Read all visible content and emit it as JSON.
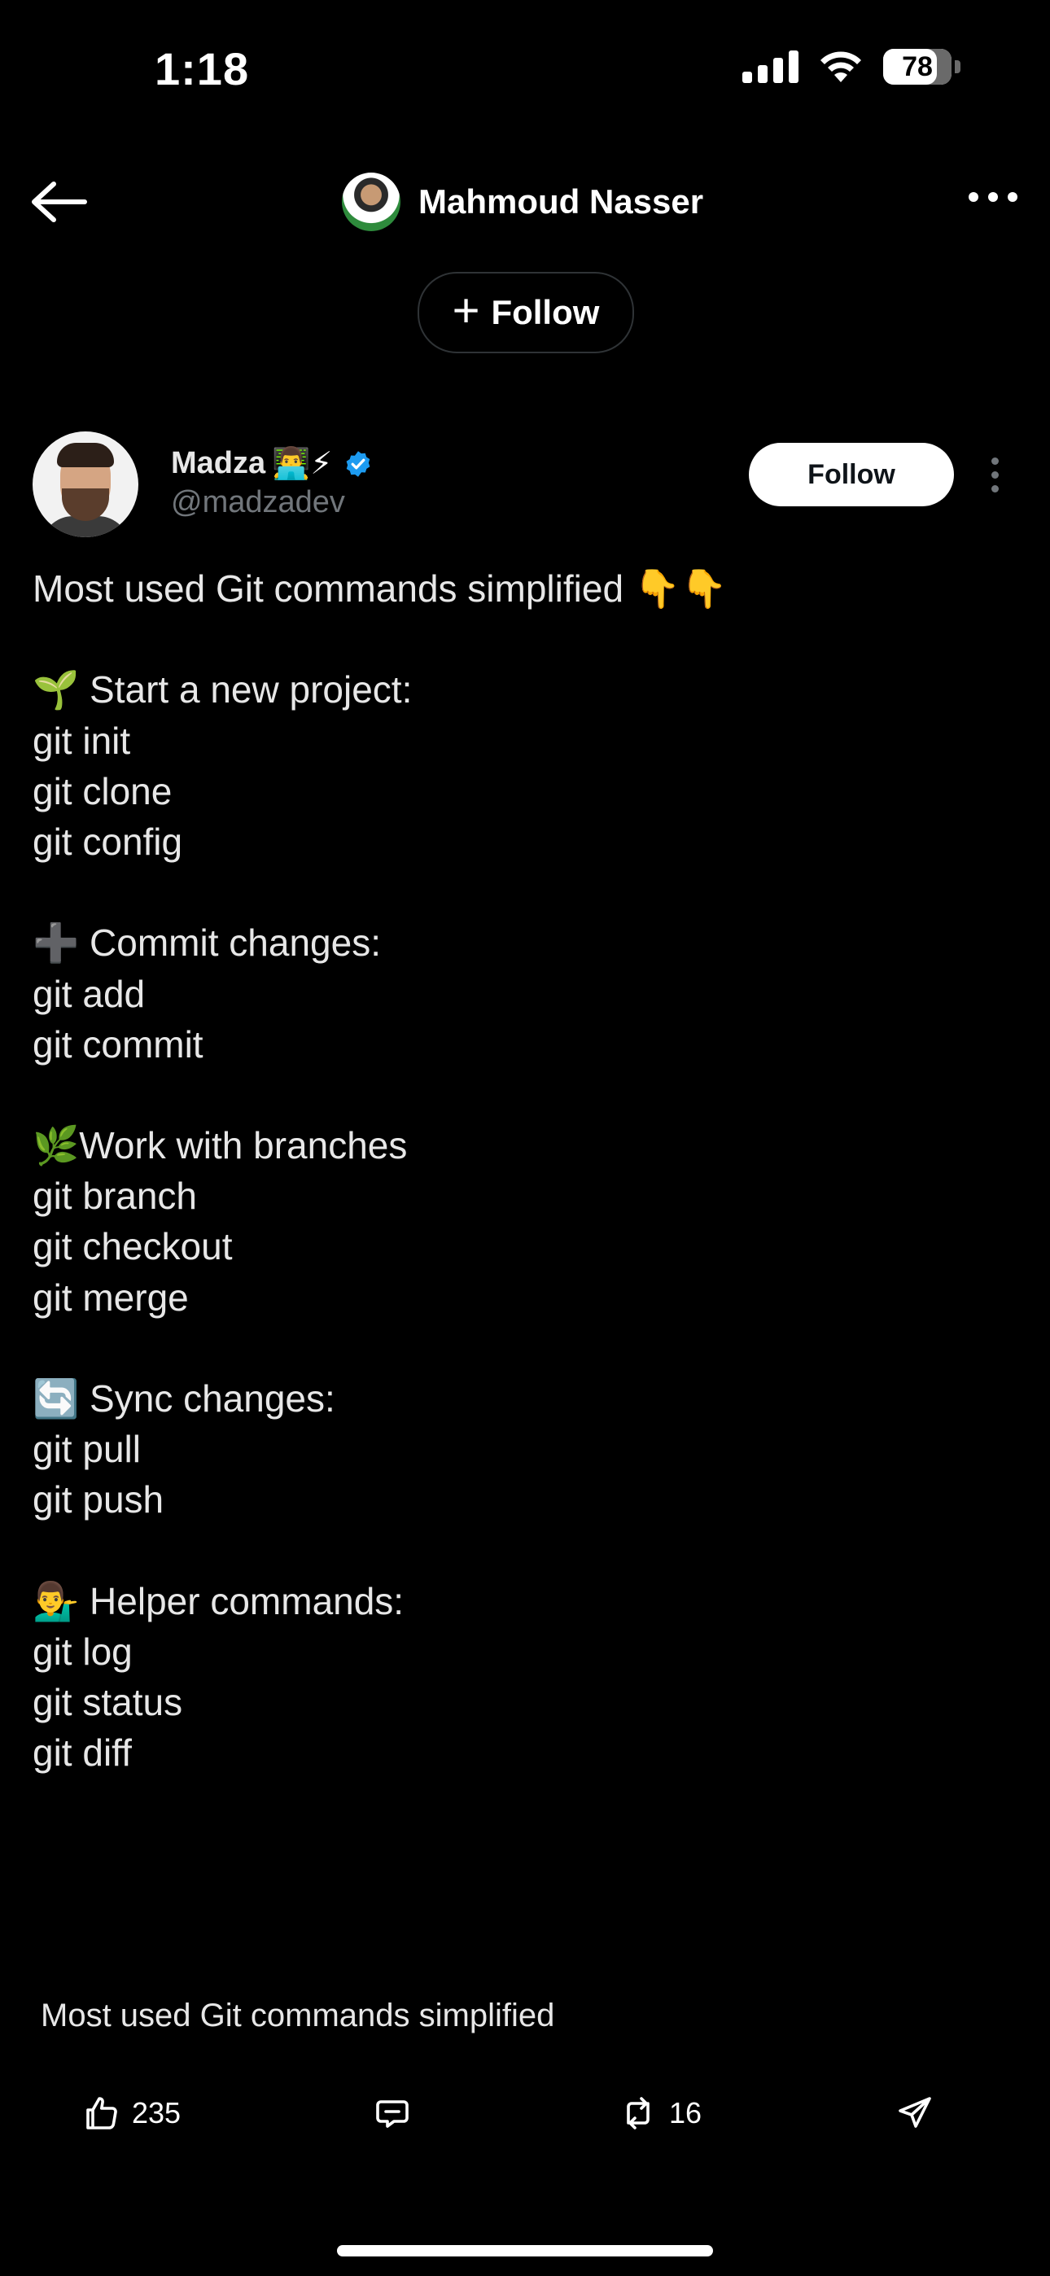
{
  "status_bar": {
    "time": "1:18",
    "battery": "78",
    "battery_level": 0.78
  },
  "header": {
    "owner_name": "Mahmoud Nasser",
    "follow_label": "Follow"
  },
  "post": {
    "author_name": "Madza",
    "author_emojis": "👨‍💻⚡",
    "author_handle": "@madzadev",
    "verified": true,
    "follow_label": "Follow",
    "lines": [
      "Most used Git commands simplified 👇👇",
      "",
      "🌱 Start a new project:",
      "git init",
      "git clone",
      "git config",
      "",
      "➕ Commit changes:",
      "git add",
      "git commit",
      "",
      "🌿Work with branches",
      "git branch",
      "git checkout",
      "git merge",
      "",
      "🔄 Sync changes:",
      "git pull",
      "git push",
      "",
      "💁‍♂️ Helper commands:",
      "git log",
      "git status",
      "git diff"
    ],
    "caption": "Most used Git commands simplified"
  },
  "actions": {
    "likes": "235",
    "reposts": "16"
  },
  "colors": {
    "background": "#000000",
    "verified": "#1d9bf0",
    "secondary_text": "#71767b"
  },
  "icons": [
    "back-arrow-icon",
    "more-horizontal-icon",
    "plus-icon",
    "verified-badge-icon",
    "more-vertical-icon",
    "like-icon",
    "reply-icon",
    "repost-icon",
    "share-icon"
  ]
}
